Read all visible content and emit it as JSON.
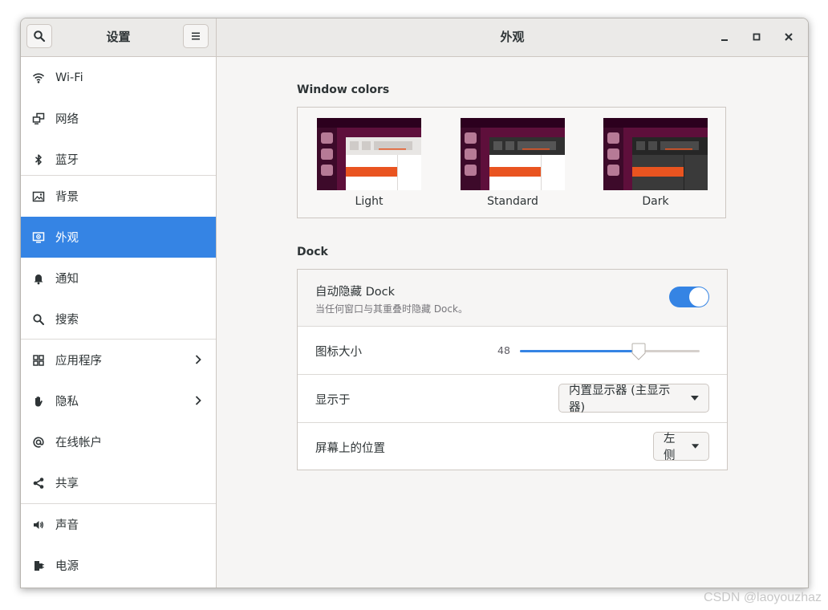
{
  "header": {
    "sidebar_title": "设置",
    "title": "外观",
    "search_icon": "search-icon",
    "menu_icon": "hamburger-menu-icon",
    "controls": [
      "minimize",
      "maximize",
      "close"
    ]
  },
  "sidebar": {
    "items": [
      {
        "label": "Wi-Fi",
        "icon": "wifi-icon"
      },
      {
        "label": "网络",
        "icon": "network-icon"
      },
      {
        "label": "蓝牙",
        "icon": "bluetooth-icon"
      },
      {
        "label": "背景",
        "icon": "background-icon"
      },
      {
        "label": "外观",
        "icon": "appearance-icon",
        "active": true
      },
      {
        "label": "通知",
        "icon": "bell-icon"
      },
      {
        "label": "搜索",
        "icon": "search-icon"
      },
      {
        "label": "应用程序",
        "icon": "apps-grid-icon",
        "has_submenu": true
      },
      {
        "label": "隐私",
        "icon": "hand-icon",
        "has_submenu": true
      },
      {
        "label": "在线帐户",
        "icon": "at-icon"
      },
      {
        "label": "共享",
        "icon": "share-icon"
      },
      {
        "label": "声音",
        "icon": "speaker-icon"
      },
      {
        "label": "电源",
        "icon": "power-plug-icon"
      }
    ]
  },
  "main": {
    "window_colors_title": "Window colors",
    "themes": [
      {
        "label": "Light"
      },
      {
        "label": "Standard"
      },
      {
        "label": "Dark"
      }
    ],
    "dock_title": "Dock",
    "autohide": {
      "label": "自动隐藏 Dock",
      "description": "当任何窗口与其重叠时隐藏 Dock。",
      "enabled": true
    },
    "icon_size": {
      "label": "图标大小",
      "value": "48",
      "fraction": 0.66
    },
    "show_on": {
      "label": "显示于",
      "selected": "内置显示器 (主显示器)"
    },
    "position": {
      "label": "屏幕上的位置",
      "selected": "左侧"
    }
  },
  "colors": {
    "accent": "#3584e4",
    "orange": "#e95420",
    "aubergine": "#5e0f3b"
  },
  "watermark": "CSDN @laoyouzhaz"
}
